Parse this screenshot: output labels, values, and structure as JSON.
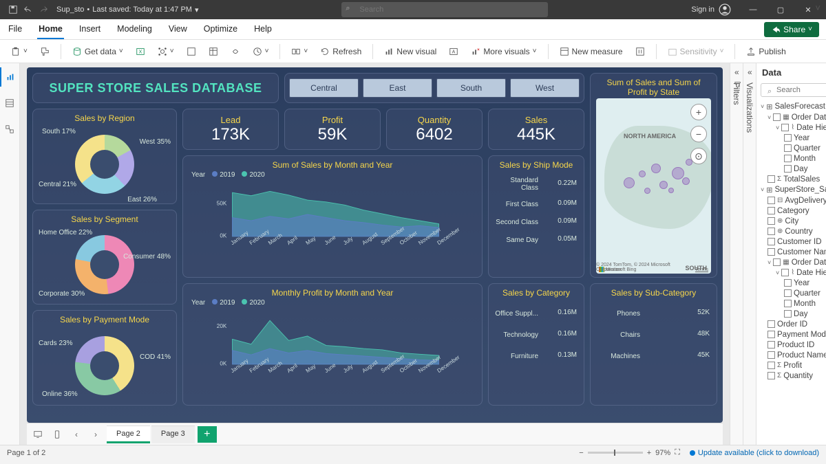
{
  "titlebar": {
    "filename": "Sup_sto",
    "saved": "Last saved: Today at 1:47 PM",
    "search_placeholder": "Search",
    "signin": "Sign in"
  },
  "menubar": {
    "tabs": [
      "File",
      "Home",
      "Insert",
      "Modeling",
      "View",
      "Optimize",
      "Help"
    ],
    "active": 1,
    "share": "Share"
  },
  "toolbar": {
    "getdata": "Get data",
    "refresh": "Refresh",
    "newvisual": "New visual",
    "morevisuals": "More visuals",
    "newmeasure": "New measure",
    "sensitivity": "Sensitivity",
    "publish": "Publish"
  },
  "dashboard": {
    "title": "SUPER STORE SALES DATABASE",
    "slicer": [
      "Central",
      "East",
      "South",
      "West"
    ],
    "kpis": [
      {
        "label": "Lead",
        "value": "173K"
      },
      {
        "label": "Profit",
        "value": "59K"
      },
      {
        "label": "Quantity",
        "value": "6402"
      },
      {
        "label": "Sales",
        "value": "445K"
      }
    ],
    "map_title": "Sum of Sales and Sum of Profit by State",
    "map_label": "NORTH AMERICA",
    "map_credit1": "© 2024 TomTom, © 2024 Microsoft Corporation",
    "map_credit2": "Terms",
    "map_bing": "Microsoft Bing",
    "map_south": "SOUTH",
    "region": {
      "title": "Sales by Region",
      "labels": {
        "west": "West 35%",
        "east": "East 26%",
        "central": "Central 21%",
        "south": "South 17%"
      }
    },
    "segment": {
      "title": "Sales by Segment",
      "labels": {
        "consumer": "Consumer 48%",
        "corporate": "Corporate 30%",
        "home": "Home Office 22%"
      }
    },
    "payment": {
      "title": "Sales by Payment Mode",
      "labels": {
        "cod": "COD 41%",
        "online": "Online 36%",
        "cards": "Cards 23%"
      }
    },
    "saleschart": {
      "title": "Sum of Sales by Month and Year",
      "year_lbl": "Year",
      "y1": "2019",
      "y2": "2020",
      "ytick": "50K",
      "y0": "0K"
    },
    "profitchart": {
      "title": "Monthly Profit by Month and Year",
      "year_lbl": "Year",
      "y1": "2019",
      "y2": "2020",
      "ytick": "20K",
      "y0": "0K"
    },
    "months": [
      "January",
      "February",
      "March",
      "April",
      "May",
      "June",
      "July",
      "August",
      "September",
      "October",
      "November",
      "December"
    ],
    "ship": {
      "title": "Sales by Ship Mode",
      "rows": [
        {
          "l": "Standard Class",
          "v": "0.22M",
          "w": 0.95
        },
        {
          "l": "First Class",
          "v": "0.09M",
          "w": 0.4
        },
        {
          "l": "Second Class",
          "v": "0.09M",
          "w": 0.4
        },
        {
          "l": "Same Day",
          "v": "0.05M",
          "w": 0.22
        }
      ]
    },
    "cat": {
      "title": "Sales by Category",
      "rows": [
        {
          "l": "Office Suppl...",
          "v": "0.16M",
          "w": 0.92
        },
        {
          "l": "Technology",
          "v": "0.16M",
          "w": 0.92
        },
        {
          "l": "Furniture",
          "v": "0.13M",
          "w": 0.76
        }
      ]
    },
    "subcat": {
      "title": "Sales by Sub-Category",
      "rows": [
        {
          "l": "Phones",
          "v": "52K",
          "w": 0.95
        },
        {
          "l": "Chairs",
          "v": "48K",
          "w": 0.88
        },
        {
          "l": "Machines",
          "v": "45K",
          "w": 0.82
        }
      ]
    }
  },
  "chart_data": [
    {
      "type": "pie",
      "title": "Sales by Region",
      "series": [
        {
          "name": "West",
          "value": 35
        },
        {
          "name": "East",
          "value": 26
        },
        {
          "name": "Central",
          "value": 21
        },
        {
          "name": "South",
          "value": 17
        }
      ]
    },
    {
      "type": "pie",
      "title": "Sales by Segment",
      "series": [
        {
          "name": "Consumer",
          "value": 48
        },
        {
          "name": "Corporate",
          "value": 30
        },
        {
          "name": "Home Office",
          "value": 22
        }
      ]
    },
    {
      "type": "pie",
      "title": "Sales by Payment Mode",
      "series": [
        {
          "name": "COD",
          "value": 41
        },
        {
          "name": "Online",
          "value": 36
        },
        {
          "name": "Cards",
          "value": 23
        }
      ]
    },
    {
      "type": "area",
      "title": "Sum of Sales by Month and Year",
      "xlabel": "",
      "ylabel": "",
      "ylim": [
        0,
        70000
      ],
      "categories": [
        "January",
        "February",
        "March",
        "April",
        "May",
        "June",
        "July",
        "August",
        "September",
        "October",
        "November",
        "December"
      ],
      "series": [
        {
          "name": "2019",
          "values": [
            25000,
            22000,
            28000,
            26000,
            30000,
            27000,
            24000,
            22000,
            20000,
            18000,
            19000,
            17000
          ]
        },
        {
          "name": "2020",
          "values": [
            60000,
            55000,
            62000,
            58000,
            50000,
            48000,
            45000,
            40000,
            36000,
            32000,
            28000,
            25000
          ]
        }
      ]
    },
    {
      "type": "area",
      "title": "Monthly Profit by Month and Year",
      "xlabel": "",
      "ylabel": "",
      "ylim": [
        0,
        25000
      ],
      "categories": [
        "January",
        "February",
        "March",
        "April",
        "May",
        "June",
        "July",
        "August",
        "September",
        "October",
        "November",
        "December"
      ],
      "series": [
        {
          "name": "2019",
          "values": [
            8000,
            6000,
            9000,
            7000,
            8500,
            7500,
            7000,
            6500,
            6000,
            5500,
            5000,
            4800
          ]
        },
        {
          "name": "2020",
          "values": [
            15000,
            12000,
            22000,
            14000,
            16000,
            11000,
            10000,
            9500,
            9000,
            8000,
            7500,
            7000
          ]
        }
      ]
    },
    {
      "type": "bar",
      "title": "Sales by Ship Mode",
      "categories": [
        "Standard Class",
        "First Class",
        "Second Class",
        "Same Day"
      ],
      "values": [
        220000,
        90000,
        90000,
        50000
      ]
    },
    {
      "type": "bar",
      "title": "Sales by Category",
      "categories": [
        "Office Supplies",
        "Technology",
        "Furniture"
      ],
      "values": [
        160000,
        160000,
        130000
      ]
    },
    {
      "type": "bar",
      "title": "Sales by Sub-Category",
      "categories": [
        "Phones",
        "Chairs",
        "Machines"
      ],
      "values": [
        52000,
        48000,
        45000
      ]
    }
  ],
  "filters_label": "Filters",
  "viz_label": "Visualizations",
  "data_panel": {
    "title": "Data",
    "search_placeholder": "Search",
    "tables": [
      {
        "name": "SalesForecast",
        "expanded": true,
        "fields": [
          {
            "name": "Order Date",
            "icon": "cal",
            "children": [
              {
                "name": "Date Hierarc...",
                "icon": "hier",
                "children": [
                  {
                    "name": "Year"
                  },
                  {
                    "name": "Quarter"
                  },
                  {
                    "name": "Month"
                  },
                  {
                    "name": "Day"
                  }
                ]
              }
            ]
          },
          {
            "name": "TotalSales",
            "icon": "sigma"
          }
        ]
      },
      {
        "name": "SuperStore_Sales_Dat...",
        "expanded": true,
        "fields": [
          {
            "name": "AvgDelivery_D...",
            "icon": "measure"
          },
          {
            "name": "Category"
          },
          {
            "name": "City",
            "icon": "globe"
          },
          {
            "name": "Country",
            "icon": "globe"
          },
          {
            "name": "Customer ID"
          },
          {
            "name": "Customer Name"
          },
          {
            "name": "Order Date",
            "icon": "cal",
            "children": [
              {
                "name": "Date Hierarc...",
                "icon": "hier",
                "children": [
                  {
                    "name": "Year"
                  },
                  {
                    "name": "Quarter"
                  },
                  {
                    "name": "Month"
                  },
                  {
                    "name": "Day"
                  }
                ]
              }
            ]
          },
          {
            "name": "Order ID"
          },
          {
            "name": "Payment Mode"
          },
          {
            "name": "Product ID"
          },
          {
            "name": "Product Name"
          },
          {
            "name": "Profit",
            "icon": "sigma"
          },
          {
            "name": "Quantity",
            "icon": "sigma"
          }
        ]
      }
    ]
  },
  "pages": {
    "tabs": [
      "Page 2",
      "Page 3"
    ],
    "active": 0
  },
  "statusbar": {
    "page": "Page 1 of 2",
    "zoom": "97%",
    "update": "Update available (click to download)"
  }
}
